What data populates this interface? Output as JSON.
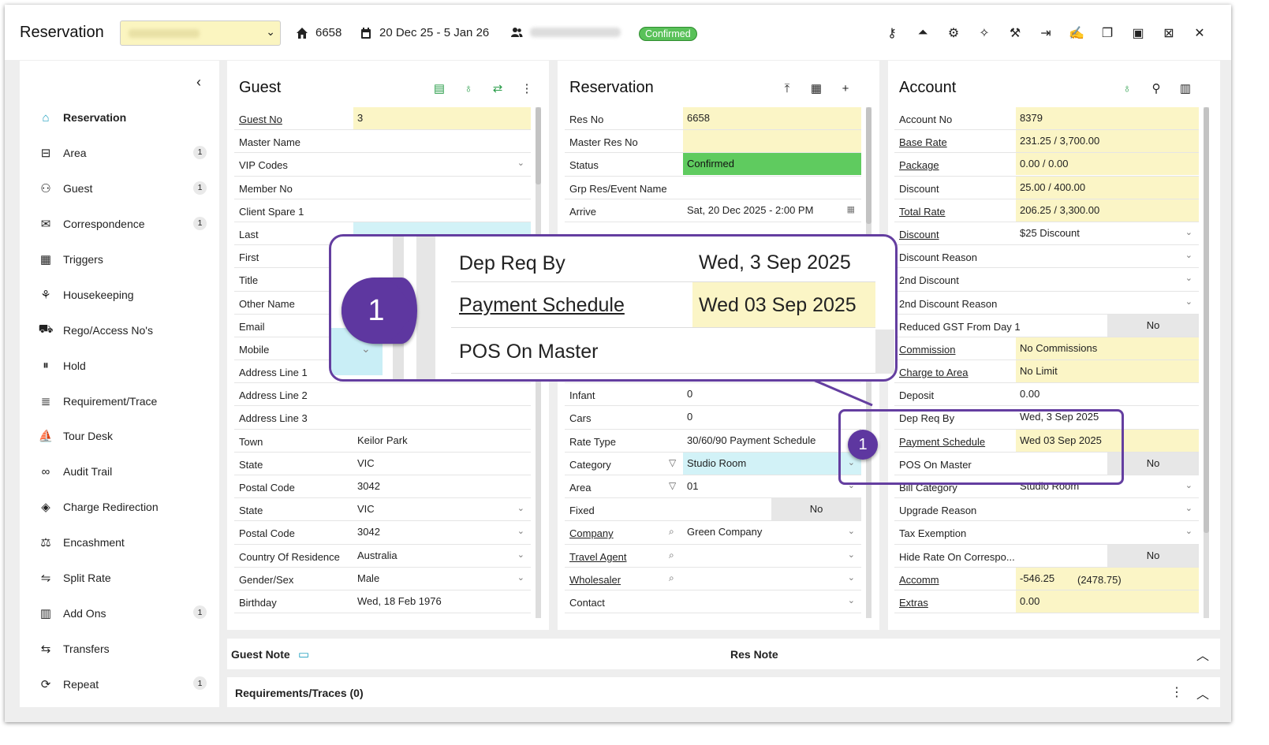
{
  "header": {
    "title": "Reservation",
    "res_no": "6658",
    "dates": "20 Dec 25 - 5 Jan 26",
    "status": "Confirmed"
  },
  "sidebar": {
    "items": [
      {
        "label": "Reservation",
        "icon": "home-icon",
        "badge": ""
      },
      {
        "label": "Area",
        "icon": "bed-icon",
        "badge": "1"
      },
      {
        "label": "Guest",
        "icon": "users-icon",
        "badge": "1"
      },
      {
        "label": "Correspondence",
        "icon": "mail-icon",
        "badge": "1"
      },
      {
        "label": "Triggers",
        "icon": "triggers-icon",
        "badge": ""
      },
      {
        "label": "Housekeeping",
        "icon": "housekeeping-icon",
        "badge": ""
      },
      {
        "label": "Rego/Access No's",
        "icon": "car-icon",
        "badge": ""
      },
      {
        "label": "Hold",
        "icon": "pause-icon",
        "badge": ""
      },
      {
        "label": "Requirement/Trace",
        "icon": "list-icon",
        "badge": ""
      },
      {
        "label": "Tour Desk",
        "icon": "tour-icon",
        "badge": ""
      },
      {
        "label": "Audit Trail",
        "icon": "glasses-icon",
        "badge": ""
      },
      {
        "label": "Charge Redirection",
        "icon": "redirect-icon",
        "badge": ""
      },
      {
        "label": "Encashment",
        "icon": "encash-icon",
        "badge": ""
      },
      {
        "label": "Split Rate",
        "icon": "split-icon",
        "badge": ""
      },
      {
        "label": "Add Ons",
        "icon": "addons-icon",
        "badge": "1"
      },
      {
        "label": "Transfers",
        "icon": "transfers-icon",
        "badge": ""
      },
      {
        "label": "Repeat",
        "icon": "repeat-icon",
        "badge": "1"
      }
    ]
  },
  "guest": {
    "title": "Guest",
    "rows": [
      {
        "label": "Guest No",
        "value": "3"
      },
      {
        "label": "Master Name",
        "value": ""
      },
      {
        "label": "VIP Codes",
        "value": ""
      },
      {
        "label": "Member No",
        "value": ""
      },
      {
        "label": "Client Spare 1",
        "value": ""
      },
      {
        "label": "Last",
        "value": ""
      },
      {
        "label": "First",
        "value": ""
      },
      {
        "label": "Title",
        "value": ""
      },
      {
        "label": "Other Name",
        "value": ""
      },
      {
        "label": "Email",
        "value": ""
      },
      {
        "label": "Mobile",
        "value": ""
      },
      {
        "label": "Address Line 1",
        "value": ""
      },
      {
        "label": "Address Line 2",
        "value": ""
      },
      {
        "label": "Address Line 3",
        "value": ""
      },
      {
        "label": "Town",
        "value": "Keilor Park"
      },
      {
        "label": "State",
        "value": "VIC"
      },
      {
        "label": "Postal Code",
        "value": "3042"
      },
      {
        "label": "State",
        "value": "VIC"
      },
      {
        "label": "Postal Code",
        "value": "3042"
      },
      {
        "label": "Country Of Residence",
        "value": "Australia"
      },
      {
        "label": "Gender/Sex",
        "value": "Male"
      },
      {
        "label": "Birthday",
        "value": "Wed, 18 Feb 1976"
      }
    ]
  },
  "reservation": {
    "title": "Reservation",
    "rows": [
      {
        "label": "Res No",
        "value": "6658"
      },
      {
        "label": "Master Res No",
        "value": ""
      },
      {
        "label": "Status",
        "value": "Confirmed"
      },
      {
        "label": "Grp Res/Event Name",
        "value": ""
      },
      {
        "label": "Arrive",
        "value": "Sat, 20 Dec 2025 - 2:00 PM"
      },
      {
        "label": "",
        "value": ""
      },
      {
        "label": "",
        "value": ""
      },
      {
        "label": "",
        "value": ""
      },
      {
        "label": "",
        "value": ""
      },
      {
        "label": "",
        "value": ""
      },
      {
        "label": "",
        "value": ""
      },
      {
        "label": "",
        "value": ""
      },
      {
        "label": "Infant",
        "value": "0"
      },
      {
        "label": "Cars",
        "value": "0"
      },
      {
        "label": "Rate Type",
        "value": "30/60/90 Payment Schedule"
      },
      {
        "label": "Category",
        "value": "Studio Room"
      },
      {
        "label": "Area",
        "value": "01"
      },
      {
        "label": "Fixed",
        "value": "No"
      },
      {
        "label": "Company",
        "value": "Green Company"
      },
      {
        "label": "Travel Agent",
        "value": ""
      },
      {
        "label": "Wholesaler",
        "value": ""
      },
      {
        "label": "Contact",
        "value": ""
      }
    ]
  },
  "account": {
    "title": "Account",
    "rows": [
      {
        "label": "Account No",
        "value": "8379"
      },
      {
        "label": "Base Rate",
        "value": "231.25 / 3,700.00"
      },
      {
        "label": "Package",
        "value": "0.00 / 0.00"
      },
      {
        "label": "Discount",
        "value": "25.00 / 400.00"
      },
      {
        "label": "Total Rate",
        "value": "206.25 / 3,300.00"
      },
      {
        "label": "Discount",
        "value": "$25 Discount"
      },
      {
        "label": "Discount Reason",
        "value": ""
      },
      {
        "label": "2nd Discount",
        "value": ""
      },
      {
        "label": "2nd Discount Reason",
        "value": ""
      },
      {
        "label": "Reduced GST From Day 1",
        "value": "No"
      },
      {
        "label": "Commission",
        "value": "No Commissions"
      },
      {
        "label": "Charge to Area",
        "value": "No Limit"
      },
      {
        "label": "Deposit",
        "value": "0.00"
      },
      {
        "label": "Dep Req By",
        "value": "Wed, 3 Sep 2025"
      },
      {
        "label": "Payment Schedule",
        "value": "Wed 03 Sep 2025"
      },
      {
        "label": "POS On Master",
        "value": "No"
      },
      {
        "label": "Bill Category",
        "value": "Studio Room"
      },
      {
        "label": "Upgrade Reason",
        "value": ""
      },
      {
        "label": "Tax Exemption",
        "value": ""
      },
      {
        "label": "Hide Rate On Correspo...",
        "value": "No"
      },
      {
        "label": "Accomm",
        "value": "-546.25",
        "value2": "(2478.75)"
      },
      {
        "label": "Extras",
        "value": "0.00"
      }
    ]
  },
  "callout": {
    "marker": "1",
    "rows": [
      {
        "label": "Dep Req By",
        "value": "Wed, 3 Sep 2025"
      },
      {
        "label": "Payment Schedule",
        "value": "Wed 03 Sep 2025"
      },
      {
        "label": "POS On Master",
        "value": ""
      }
    ]
  },
  "notes": {
    "guest_note": "Guest Note",
    "res_note": "Res Note",
    "requirements": "Requirements/Traces (0)"
  }
}
